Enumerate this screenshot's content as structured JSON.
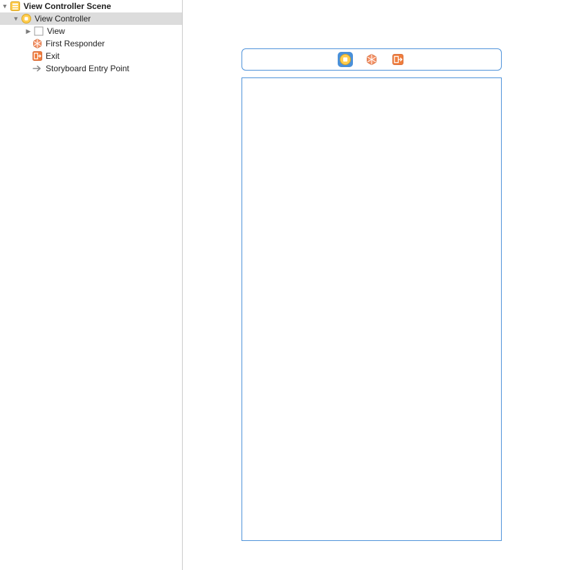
{
  "sidebar": {
    "scene": {
      "label": "View Controller Scene",
      "icon": "storyboard-scene-icon"
    },
    "controller": {
      "label": "View Controller",
      "icon": "view-controller-icon",
      "selected": true
    },
    "view": {
      "label": "View",
      "icon": "view-icon"
    },
    "first_responder": {
      "label": "First Responder",
      "icon": "first-responder-icon"
    },
    "exit": {
      "label": "Exit",
      "icon": "exit-icon"
    },
    "entry_point": {
      "label": "Storyboard Entry Point",
      "icon": "arrow-right-icon"
    }
  },
  "canvas": {
    "header_icons": [
      "view-controller-icon",
      "first-responder-icon",
      "exit-icon"
    ],
    "selected_header_icon": 0
  },
  "colors": {
    "selection_blue": "#4a90d9",
    "orange": "#f07d3c",
    "yellow_fill": "#ffcc4d",
    "yellow_stroke": "#d9a624",
    "row_select": "#dcdcdc",
    "arrow_gray": "#b9b9b9"
  }
}
